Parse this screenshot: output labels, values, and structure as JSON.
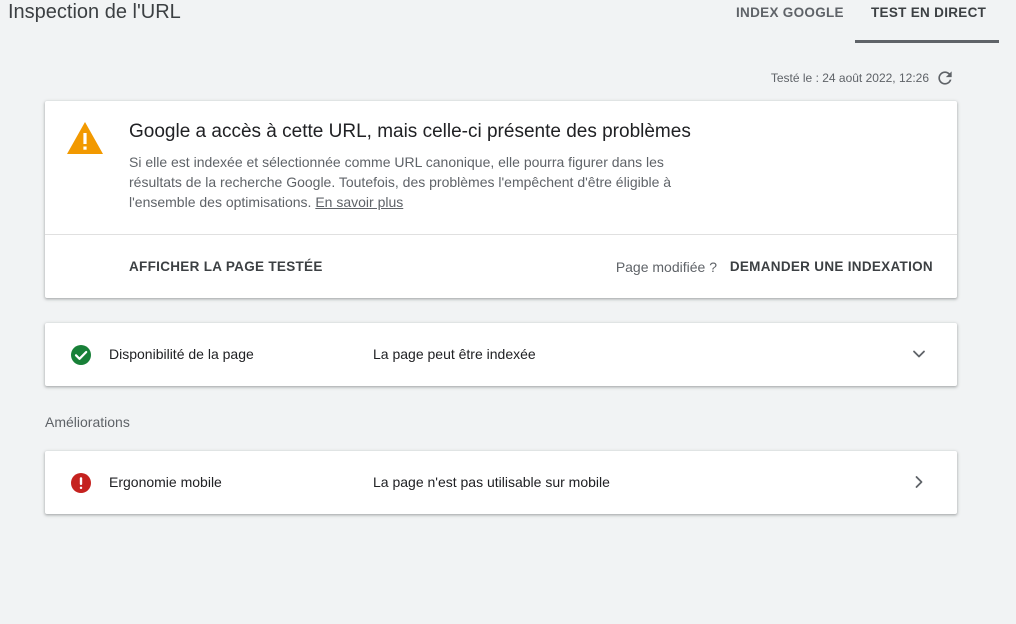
{
  "header": {
    "title": "Inspection de l'URL",
    "tabs": [
      {
        "label": "INDEX GOOGLE",
        "active": false
      },
      {
        "label": "TEST EN DIRECT",
        "active": true
      }
    ]
  },
  "test_info": {
    "tested_at": "Testé le : 24 août 2022, 12:26",
    "refresh_icon": "refresh-icon"
  },
  "status_card": {
    "icon": "warning-icon",
    "title": "Google a accès à cette URL, mais celle-ci présente des problèmes",
    "description": "Si elle est indexée et sélectionnée comme URL canonique, elle pourra figurer dans les résultats de la recherche Google. Toutefois, des problèmes l'empêchent d'être éligible à l'ensemble des optimisations.",
    "learn_more": "En savoir plus",
    "view_tested_page": "AFFICHER LA PAGE TESTÉE",
    "page_modified": "Page modifiée ?",
    "request_indexing": "DEMANDER UNE INDEXATION"
  },
  "availability": {
    "icon": "check-circle-icon",
    "label": "Disponibilité de la page",
    "value": "La page peut être indexée",
    "chevron": "chevron-down-icon"
  },
  "enhancements": {
    "label": "Améliorations",
    "items": [
      {
        "icon": "error-icon",
        "label": "Ergonomie mobile",
        "value": "La page n'est pas utilisable sur mobile",
        "chevron": "chevron-right-icon"
      }
    ]
  },
  "colors": {
    "warning": "#f29900",
    "success": "#188038",
    "error": "#c5221f",
    "background": "#f1f3f4"
  }
}
